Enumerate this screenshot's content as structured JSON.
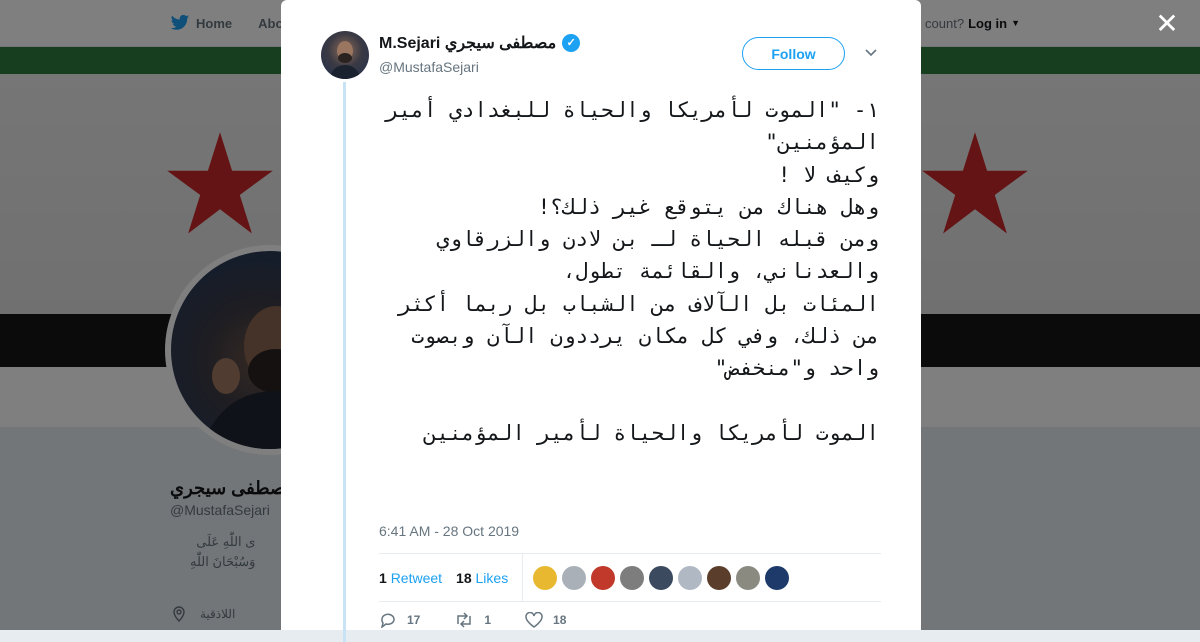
{
  "nav": {
    "home_label": "Home",
    "about_label": "Abo",
    "account_prompt": "count?",
    "login_label": "Log in"
  },
  "profile": {
    "name": "مصطفى سيجري",
    "handle": "@MustafaSejari",
    "bio_line1": "ى اللّٰهِ عَلَى",
    "bio_line2": "وَسُبْحَانَ اللّٰهِ",
    "location": "اللاذقية"
  },
  "tweet": {
    "display_name": "M.Sejari مصطفى سيجري",
    "handle": "@MustafaSejari",
    "follow_label": "Follow",
    "lines": [
      "١- \"الموت لأمريكا والحياة للبغدادي أمير المؤمنين\"",
      "وكيف لا !",
      "وهل هناك من يتوقع غير ذلك؟!",
      "ومن قبله الحياة لـ بن لادن والزرقاوي والعدناني، والقائمة تطول،",
      "المئات بل الآلاف من الشباب بل ربما أكثر من ذلك، وفي كل مكان يرددون الآن وبصوت واحد و\"منخفض\"",
      "",
      "الموت لأمريكا والحياة لأمير المؤمنين"
    ],
    "timestamp": "6:41 AM - 28 Oct 2019",
    "retweet_count": "1",
    "retweet_label": "Retweet",
    "likes_count": "18",
    "likes_label": "Likes",
    "reply_count": "17",
    "retweets_action_count": "1",
    "likes_action_count": "18"
  },
  "liker_colors": [
    "#e8b830",
    "#a9b0b8",
    "#c0392b",
    "#7d7d7d",
    "#3b4a5e",
    "#b0b8c4",
    "#5a3e2b",
    "#8a8a80",
    "#1e3a6a"
  ],
  "colors": {
    "accent": "#1da1f2",
    "flag_green": "#2f7d3c",
    "flag_red_star": "#c8282b",
    "flag_black": "#161616"
  }
}
